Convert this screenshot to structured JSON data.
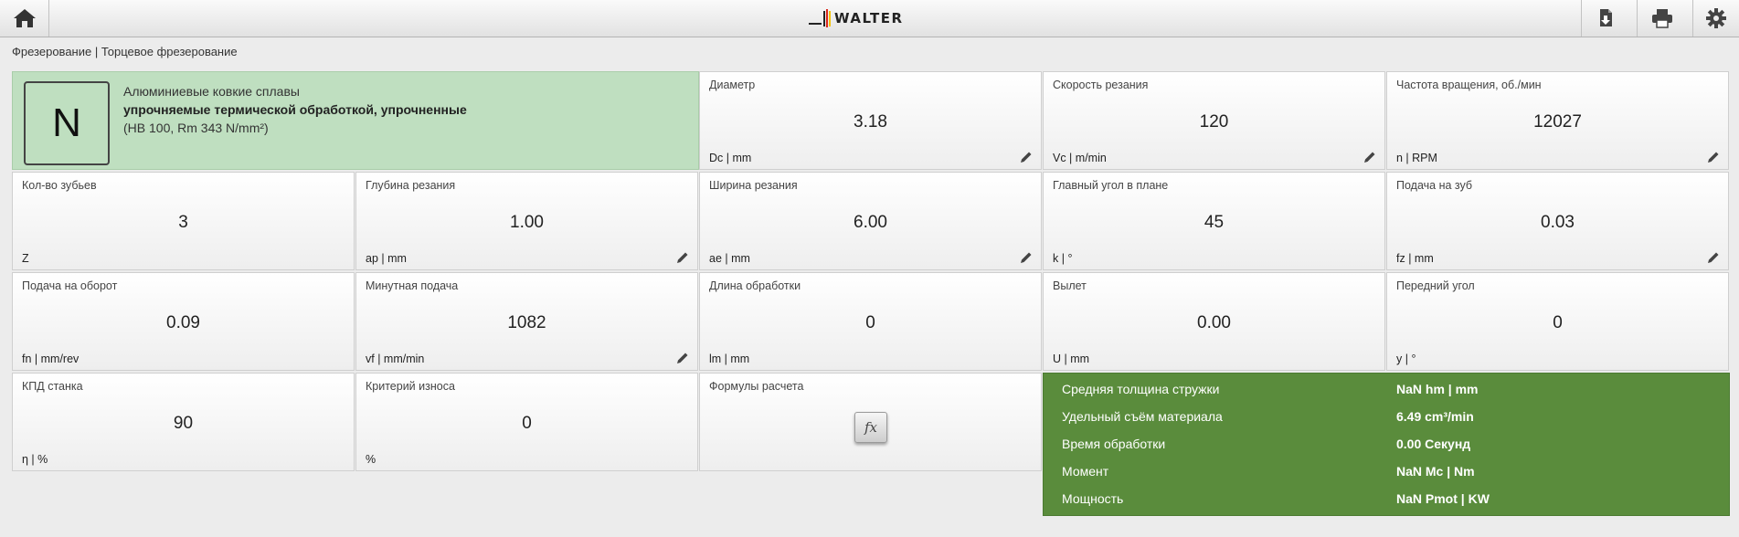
{
  "header": {
    "logo_text": "WALTER",
    "icons": [
      "home-icon",
      "export-icon",
      "print-icon",
      "gear-icon"
    ]
  },
  "breadcrumb": "Фрезерование | Торцевое фрезерование",
  "material": {
    "group": "N",
    "line1": "Алюминиевые ковкие сплавы",
    "line2": "упрочняемые термической обработкой, упрочненные",
    "line3": "(HB 100, Rm 343 N/mm²)"
  },
  "params": {
    "diameter": {
      "label": "Диаметр",
      "value": "3.18",
      "unit": "Dc | mm"
    },
    "cutting_speed": {
      "label": "Скорость резания",
      "value": "120",
      "unit": "Vc | m/min"
    },
    "rpm": {
      "label": "Частота вращения, об./мин",
      "value": "12027",
      "unit": "n | RPM"
    },
    "teeth": {
      "label": "Кол-во зубьев",
      "value": "3",
      "unit": "Z"
    },
    "depth": {
      "label": "Глубина резания",
      "value": "1.00",
      "unit": "ap | mm"
    },
    "width": {
      "label": "Ширина резания",
      "value": "6.00",
      "unit": "ae | mm"
    },
    "angle": {
      "label": "Главный угол в плане",
      "value": "45",
      "unit": "k | °"
    },
    "feed_tooth": {
      "label": "Подача на зуб",
      "value": "0.03",
      "unit": "fz | mm"
    },
    "feed_rev": {
      "label": "Подача на оборот",
      "value": "0.09",
      "unit": "fn | mm/rev"
    },
    "feed_min": {
      "label": "Минутная подача",
      "value": "1082",
      "unit": "vf | mm/min"
    },
    "length": {
      "label": "Длина обработки",
      "value": "0",
      "unit": "lm | mm"
    },
    "overhang": {
      "label": "Вылет",
      "value": "0.00",
      "unit": "U | mm"
    },
    "rake": {
      "label": "Передний угол",
      "value": "0",
      "unit": "y | °"
    },
    "efficiency": {
      "label": "КПД станка",
      "value": "90",
      "unit": "η | %"
    },
    "wear": {
      "label": "Критерий износа",
      "value": "0",
      "unit": "%"
    },
    "formulas": {
      "label": "Формулы расчета",
      "button": "fx"
    }
  },
  "results": [
    {
      "label": "Средняя толщина стружки",
      "value": "NaN hm | mm"
    },
    {
      "label": "Удельный съём материала",
      "value": "6.49 cm³/min"
    },
    {
      "label": "Время обработки",
      "value": "0.00 Секунд"
    },
    {
      "label": "Момент",
      "value": "NaN Mc | Nm"
    },
    {
      "label": "Мощность",
      "value": "NaN Pmot | KW"
    }
  ],
  "colors": {
    "material_bg": "#bfdfc0",
    "results_bg": "#5a8c3c",
    "logo_accent_red": "#d8261c",
    "logo_accent_yellow": "#f2c200"
  }
}
